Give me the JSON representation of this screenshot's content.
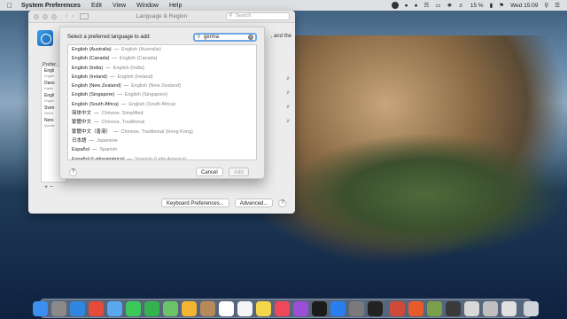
{
  "menubar": {
    "apple": "",
    "items": [
      "System Preferences",
      "Edit",
      "View",
      "Window",
      "Help"
    ],
    "battery": "15 %",
    "clock": "Wed 15:09"
  },
  "window": {
    "title": "Language & Region",
    "search_placeholder": "Search",
    "and_the": ", and the",
    "preferred_label": "Prefer",
    "bg_languages": [
      {
        "name": "Engli",
        "sub": "Englis"
      },
      {
        "name": "Dans",
        "sub": "Danis"
      },
      {
        "name": "Engli",
        "sub": "Englis"
      },
      {
        "name": "Sven",
        "sub": "Swed"
      },
      {
        "name": "Nors",
        "sub": "Norwe"
      }
    ],
    "keyboard_prefs": "Keyboard Preferences...",
    "advanced": "Advanced...",
    "help": "?"
  },
  "sheet": {
    "prompt": "Select a preferred language to add:",
    "search_value": "germa",
    "languages": [
      {
        "native": "English (Australia)",
        "translated": "English (Australia)"
      },
      {
        "native": "English (Canada)",
        "translated": "English (Canada)"
      },
      {
        "native": "English (India)",
        "translated": "English (India)"
      },
      {
        "native": "English (Ireland)",
        "translated": "English (Ireland)"
      },
      {
        "native": "English (New Zealand)",
        "translated": "English (New Zealand)"
      },
      {
        "native": "English (Singapore)",
        "translated": "English (Singapore)"
      },
      {
        "native": "English (South Africa)",
        "translated": "English (South Africa)"
      },
      {
        "native": "简体中文",
        "translated": "Chinese, Simplified"
      },
      {
        "native": "繁體中文",
        "translated": "Chinese, Traditional"
      },
      {
        "native": "繁體中文（香港）",
        "translated": "Chinese, Traditional (Hong Kong)"
      },
      {
        "native": "日本語",
        "translated": "Japanese"
      },
      {
        "native": "Español",
        "translated": "Spanish"
      },
      {
        "native": "Español (Latinoamérica)",
        "translated": "Spanish (Latin America)"
      }
    ],
    "separator": "—",
    "cancel": "Cancel",
    "add": "Add",
    "help": "?"
  },
  "dock": {
    "icons": [
      {
        "name": "finder-icon",
        "color": "#3c8ef0"
      },
      {
        "name": "launchpad-icon",
        "color": "#8a8a8a"
      },
      {
        "name": "safari-icon",
        "color": "#2f86e0"
      },
      {
        "name": "chrome-icon",
        "color": "#e64a3b"
      },
      {
        "name": "mail-icon",
        "color": "#5aa8f0"
      },
      {
        "name": "messages-icon",
        "color": "#3cc95a"
      },
      {
        "name": "facetime-icon",
        "color": "#33b24f"
      },
      {
        "name": "maps-icon",
        "color": "#6cc36a"
      },
      {
        "name": "photos-icon",
        "color": "#f2b632"
      },
      {
        "name": "contacts-icon",
        "color": "#b88a5a"
      },
      {
        "name": "calendar-icon",
        "color": "#ffffff"
      },
      {
        "name": "reminders-icon",
        "color": "#f5f5f5"
      },
      {
        "name": "notes-icon",
        "color": "#f5d54a"
      },
      {
        "name": "music-icon",
        "color": "#f0475a"
      },
      {
        "name": "podcasts-icon",
        "color": "#9b4fd6"
      },
      {
        "name": "tv-icon",
        "color": "#1c1c1c"
      },
      {
        "name": "app-store-icon",
        "color": "#2a7ff0"
      },
      {
        "name": "system-preferences-icon",
        "color": "#7a7a7a"
      },
      {
        "name": "terminal-icon",
        "color": "#222222"
      },
      {
        "name": "app-icon-1",
        "color": "#d04a3a"
      },
      {
        "name": "app-icon-2",
        "color": "#e85a2a"
      },
      {
        "name": "app-icon-3",
        "color": "#7aa04a"
      },
      {
        "name": "app-icon-4",
        "color": "#3a3a3a"
      },
      {
        "name": "app-icon-5",
        "color": "#d8d8d8"
      },
      {
        "name": "app-icon-6",
        "color": "#c0c0c0"
      },
      {
        "name": "app-icon-7",
        "color": "#e0e0e0"
      },
      {
        "name": "trash-icon",
        "color": "#cfd4da"
      }
    ]
  }
}
